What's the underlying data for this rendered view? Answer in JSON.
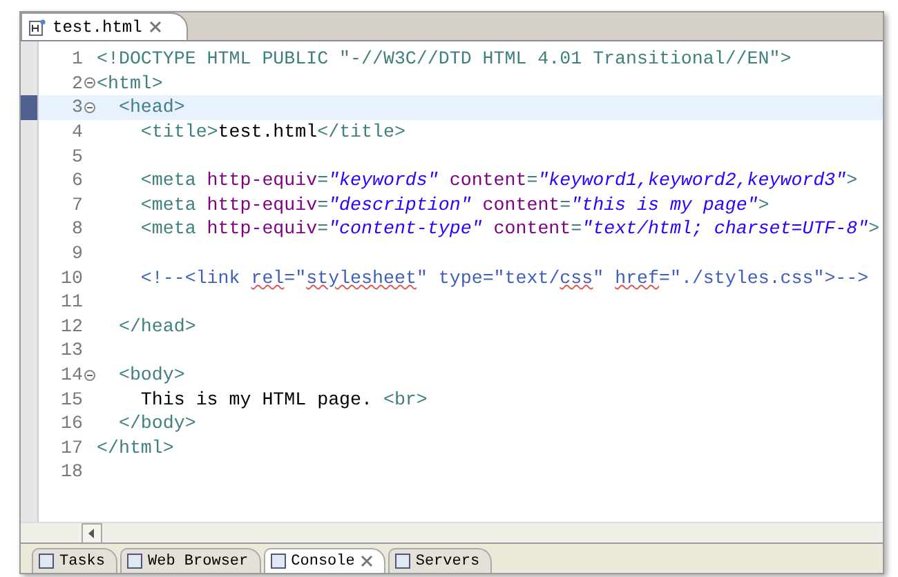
{
  "editor_tab": {
    "label": "test.html",
    "selected": true
  },
  "lines": [
    {
      "number": "1",
      "foldable": false,
      "current": false,
      "tokens": [
        {
          "kind": "doctype",
          "text": "<!DOCTYPE HTML PUBLIC \"-//W3C//DTD HTML 4.01 Transitional//EN\">"
        }
      ]
    },
    {
      "number": "2",
      "foldable": true,
      "current": false,
      "tokens": [
        {
          "kind": "tag",
          "text": "<html>"
        }
      ]
    },
    {
      "number": "3",
      "foldable": true,
      "current": true,
      "tokens": [
        {
          "kind": "tag",
          "text": "  <head>"
        }
      ]
    },
    {
      "number": "4",
      "foldable": false,
      "current": false,
      "tokens": [
        {
          "kind": "tag",
          "text": "    <title>"
        },
        {
          "kind": "text",
          "text": "test.html"
        },
        {
          "kind": "tag",
          "text": "</title>"
        }
      ]
    },
    {
      "number": "5",
      "foldable": false,
      "current": false
    },
    {
      "number": "6",
      "foldable": false,
      "current": false,
      "tokens": [
        {
          "kind": "tag",
          "text": "    <meta "
        },
        {
          "kind": "attr",
          "text": "http-equiv"
        },
        {
          "kind": "tag",
          "text": "="
        },
        {
          "kind": "value",
          "text": "\"keywords\""
        },
        {
          "kind": "attr",
          "text": " content"
        },
        {
          "kind": "tag",
          "text": "="
        },
        {
          "kind": "value",
          "text": "\"keyword1,keyword2,keyword3\""
        },
        {
          "kind": "tag",
          "text": ">"
        }
      ]
    },
    {
      "number": "7",
      "foldable": false,
      "current": false,
      "tokens": [
        {
          "kind": "tag",
          "text": "    <meta "
        },
        {
          "kind": "attr",
          "text": "http-equiv"
        },
        {
          "kind": "tag",
          "text": "="
        },
        {
          "kind": "value",
          "text": "\"description\""
        },
        {
          "kind": "attr",
          "text": " content"
        },
        {
          "kind": "tag",
          "text": "="
        },
        {
          "kind": "value",
          "text": "\"this is my page\""
        },
        {
          "kind": "tag",
          "text": ">"
        }
      ]
    },
    {
      "number": "8",
      "foldable": false,
      "current": false,
      "tokens": [
        {
          "kind": "tag",
          "text": "    <meta "
        },
        {
          "kind": "attr",
          "text": "http-equiv"
        },
        {
          "kind": "tag",
          "text": "="
        },
        {
          "kind": "value",
          "text": "\"content-type\""
        },
        {
          "kind": "attr",
          "text": " content"
        },
        {
          "kind": "tag",
          "text": "="
        },
        {
          "kind": "value",
          "text": "\"text/html; charset=UTF-8\""
        },
        {
          "kind": "tag",
          "text": ">"
        }
      ]
    },
    {
      "number": "9",
      "foldable": false,
      "current": false
    },
    {
      "number": "10",
      "foldable": false,
      "current": false,
      "tokens": [
        {
          "kind": "comment",
          "text": "    <!--<link "
        },
        {
          "kind": "flagged",
          "text": "rel"
        },
        {
          "kind": "comment",
          "text": "=\""
        },
        {
          "kind": "flagged",
          "text": "stylesheet"
        },
        {
          "kind": "comment",
          "text": "\" type=\"text/"
        },
        {
          "kind": "flagged",
          "text": "css"
        },
        {
          "kind": "comment",
          "text": "\" "
        },
        {
          "kind": "flagged",
          "text": "href"
        },
        {
          "kind": "comment",
          "text": "=\"./styles.css\">-->"
        }
      ]
    },
    {
      "number": "11",
      "foldable": false,
      "current": false
    },
    {
      "number": "12",
      "foldable": false,
      "current": false,
      "tokens": [
        {
          "kind": "tag",
          "text": "  </head>"
        }
      ]
    },
    {
      "number": "13",
      "foldable": false,
      "current": false
    },
    {
      "number": "14",
      "foldable": true,
      "current": false,
      "tokens": [
        {
          "kind": "tag",
          "text": "  <body>"
        }
      ]
    },
    {
      "number": "15",
      "foldable": false,
      "current": false,
      "tokens": [
        {
          "kind": "text",
          "text": "    This is my HTML page. "
        },
        {
          "kind": "tag",
          "text": "<br>"
        }
      ]
    },
    {
      "number": "16",
      "foldable": false,
      "current": false,
      "tokens": [
        {
          "kind": "tag",
          "text": "  </body>"
        }
      ]
    },
    {
      "number": "17",
      "foldable": false,
      "current": false,
      "tokens": [
        {
          "kind": "tag",
          "text": "</html>"
        }
      ]
    },
    {
      "number": "18",
      "foldable": false,
      "current": false
    }
  ],
  "bottom_tabs": [
    {
      "label": "Tasks",
      "selected": false,
      "closable": false
    },
    {
      "label": "Web Browser",
      "selected": false,
      "closable": false
    },
    {
      "label": "Console",
      "selected": true,
      "closable": true
    },
    {
      "label": "Servers",
      "selected": false,
      "closable": false
    }
  ]
}
